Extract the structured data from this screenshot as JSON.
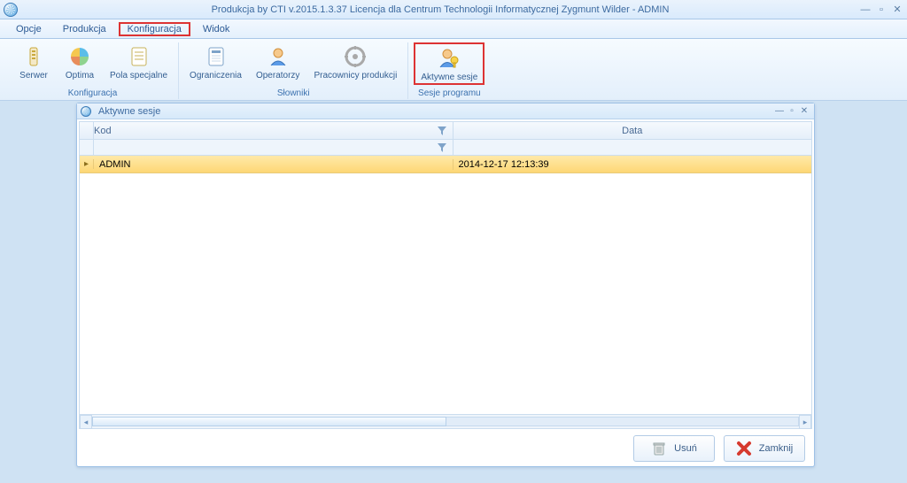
{
  "app": {
    "title": "Produkcja by CTI v.2015.1.3.37 Licencja dla Centrum Technologii Informatycznej Zygmunt Wilder - ADMIN"
  },
  "menu": {
    "items": [
      "Opcje",
      "Produkcja",
      "Konfiguracja",
      "Widok"
    ],
    "highlighted": "Konfiguracja"
  },
  "ribbon": {
    "groups": [
      {
        "title": "Konfiguracja",
        "items": [
          {
            "label": "Serwer",
            "icon": "server-icon"
          },
          {
            "label": "Optima",
            "icon": "optima-icon"
          },
          {
            "label": "Pola specjalne",
            "icon": "fields-icon"
          }
        ]
      },
      {
        "title": "Słowniki",
        "items": [
          {
            "label": "Ograniczenia",
            "icon": "limits-icon"
          },
          {
            "label": "Operatorzy",
            "icon": "operators-icon"
          },
          {
            "label": "Pracownicy produkcji",
            "icon": "workers-icon"
          }
        ]
      },
      {
        "title": "Sesje programu",
        "items": [
          {
            "label": "Aktywne sesje",
            "icon": "sessions-icon",
            "highlighted": true
          }
        ]
      }
    ]
  },
  "childWindow": {
    "title": "Aktywne sesje",
    "columns": [
      "Kod",
      "Data"
    ],
    "rows": [
      {
        "kod": "ADMIN",
        "data": "2014-12-17 12:13:39"
      }
    ],
    "buttons": {
      "delete": "Usuń",
      "close": "Zamknij"
    }
  }
}
